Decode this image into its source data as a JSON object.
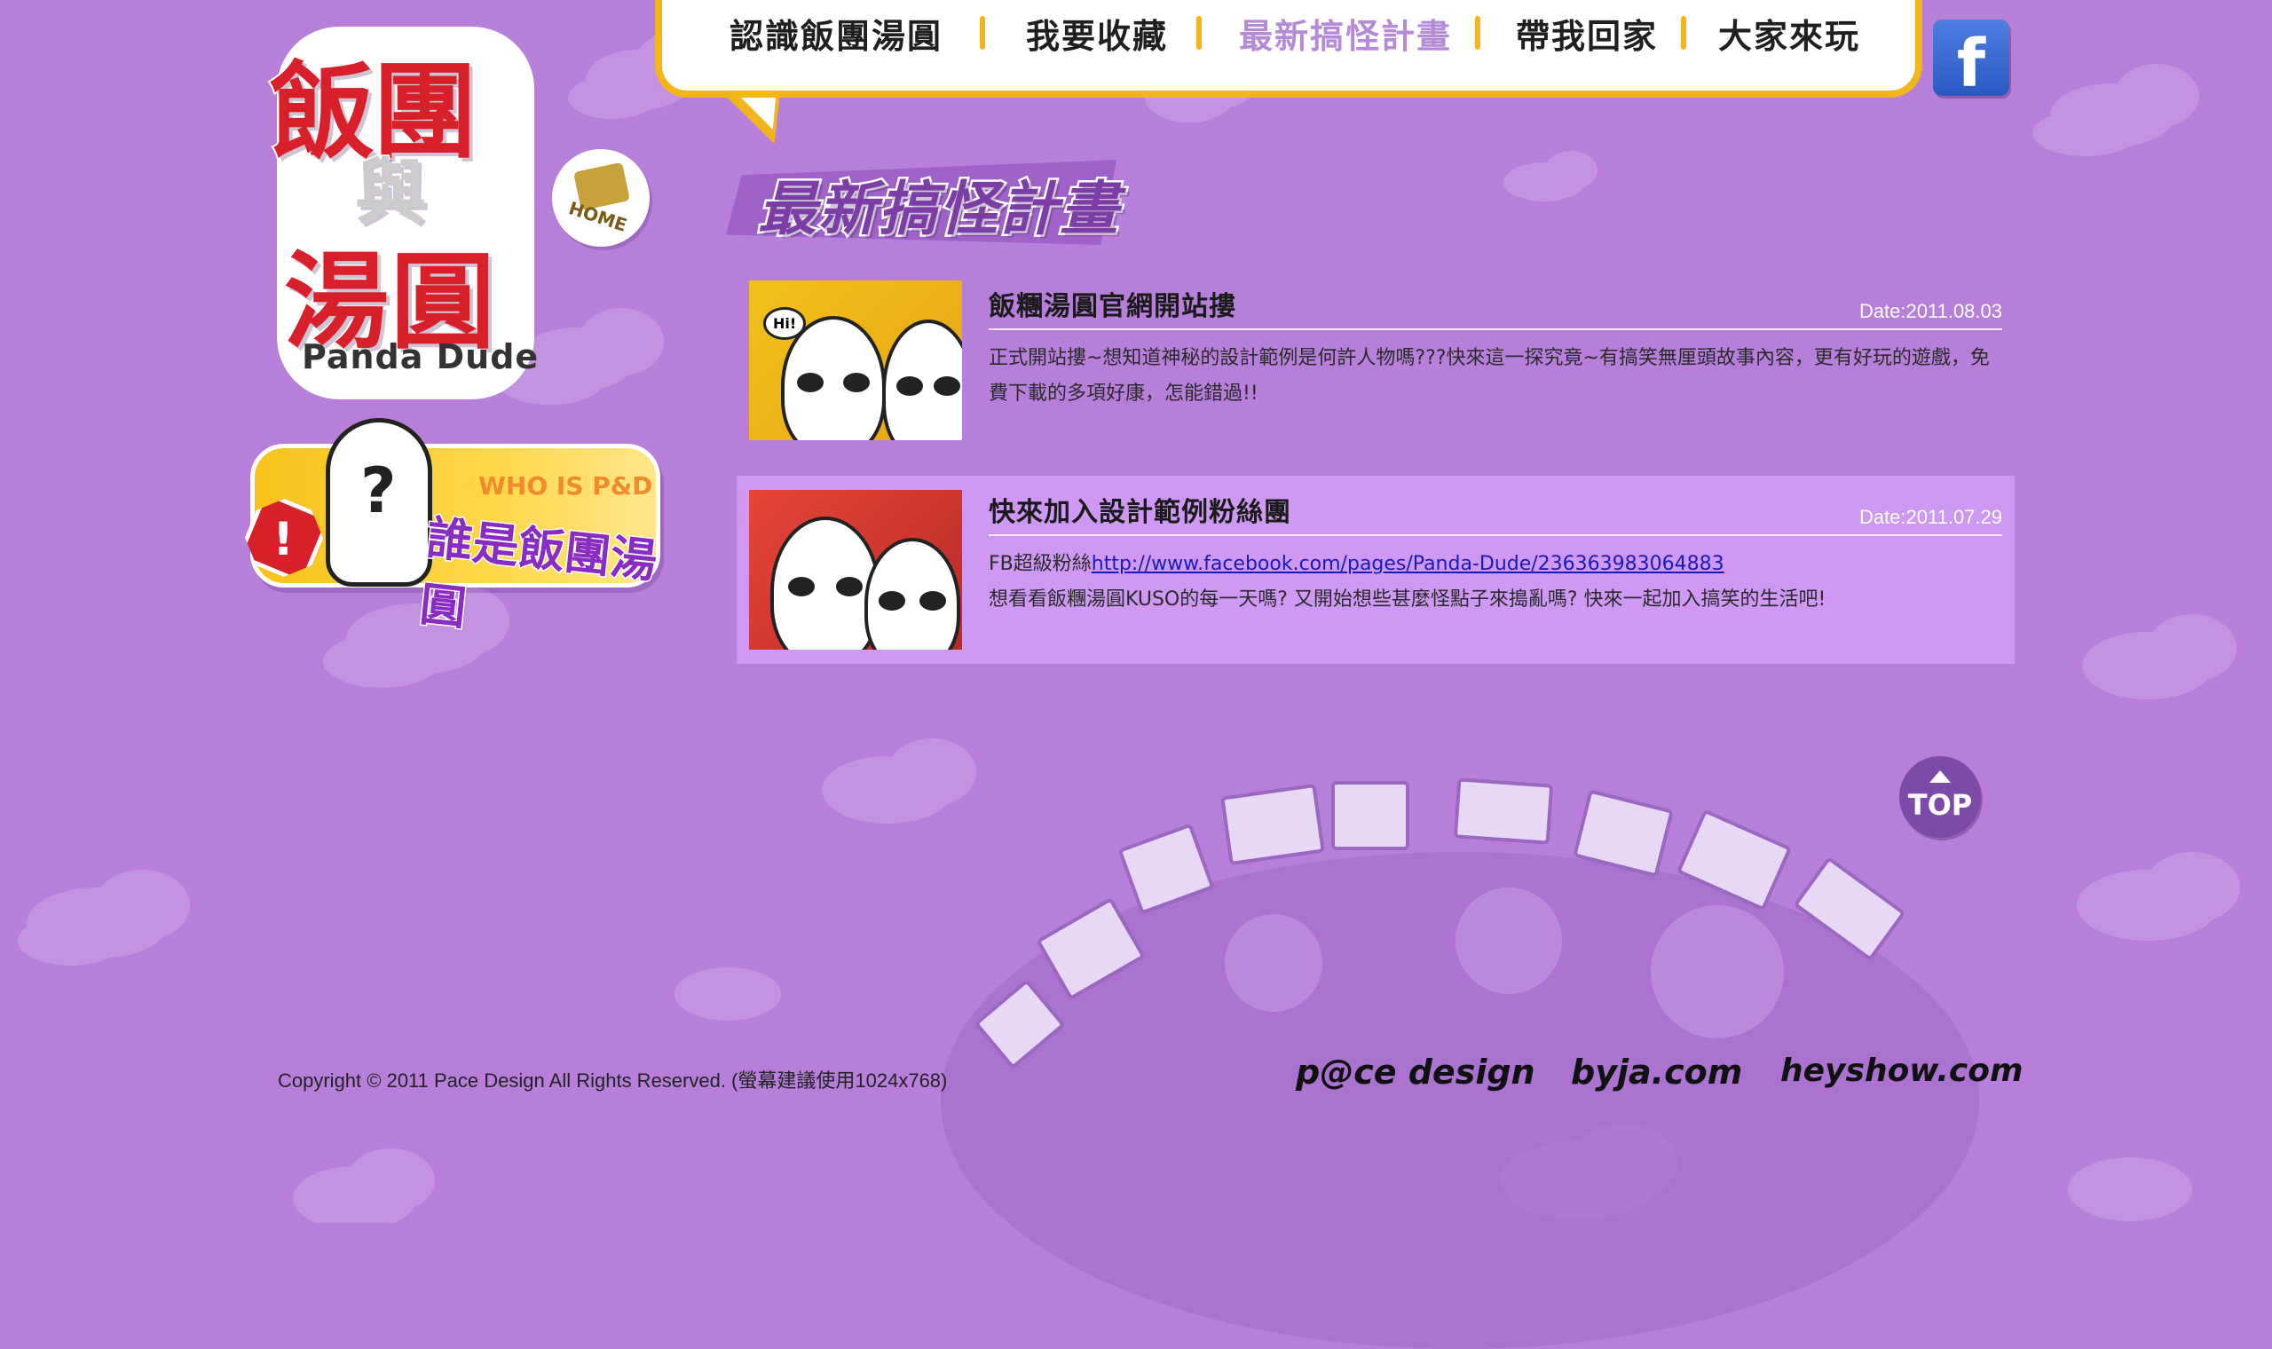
{
  "logo": {
    "chars": [
      "飯",
      "團",
      "與",
      "湯",
      "圓"
    ],
    "subtitle": "Panda Dude",
    "home_label": "HOME"
  },
  "who_banner": {
    "english": "WHO IS P&D",
    "chinese": "誰是飯團湯圓",
    "alert": "!",
    "question": "?"
  },
  "nav": {
    "items": [
      {
        "label": "認識飯團湯圓",
        "active": false
      },
      {
        "label": "我要收藏",
        "active": false
      },
      {
        "label": "最新搞怪計畫",
        "active": true
      },
      {
        "label": "帶我回家",
        "active": false
      },
      {
        "label": "大家來玩",
        "active": false
      }
    ],
    "facebook_icon": "facebook-icon",
    "facebook_letter": "f"
  },
  "section": {
    "title": "最新搞怪計畫"
  },
  "news": [
    {
      "title": "飯糰湯圓官網開站摟",
      "date": "Date:2011.08.03",
      "body": "正式開站摟~想知道神秘的設計範例是何許人物嗎???快來這一探究竟~有搞笑無厘頭故事內容，更有好玩的遊戲，免費下載的多項好康，怎能錯過!!",
      "thumb_text": "Hi!"
    },
    {
      "title": "快來加入設計範例粉絲團",
      "date": "Date:2011.07.29",
      "body_prefix": "FB超級粉絲",
      "link": "http://www.facebook.com/pages/Panda-Dude/236363983064883",
      "body": "想看看飯糰湯圓KUSO的每一天嗎? 又開始想些甚麼怪點子來搗亂嗎? 快來一起加入搞笑的生活吧!"
    }
  ],
  "top_button": "TOP",
  "footer": {
    "copyright": "Copyright © 2011 Pace Design All Rights Reserved. (螢幕建議使用1024x768)",
    "brands": [
      "p@ce design",
      "byja.com",
      "heyshow.com"
    ]
  },
  "colors": {
    "background": "#b77fd9",
    "nav_border": "#f2b61c",
    "active_nav": "#b58ad6",
    "highlight_row": "#cf98f2",
    "logo_red": "#d8202a"
  }
}
